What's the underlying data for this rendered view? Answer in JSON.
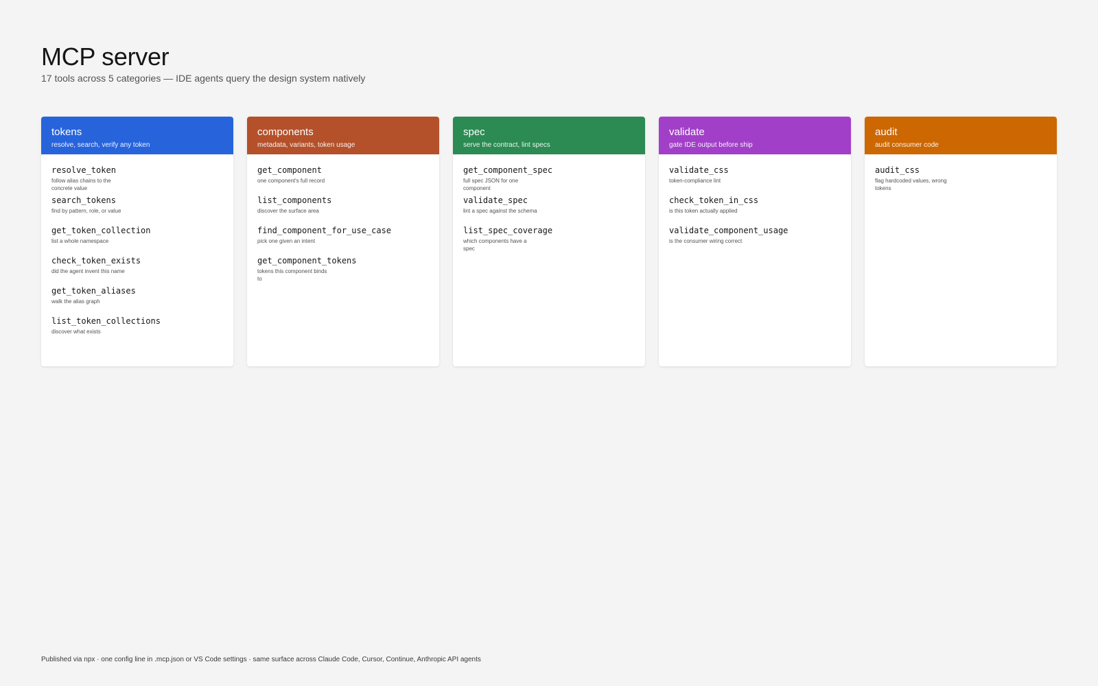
{
  "header": {
    "title": "MCP server",
    "subtitle": "17 tools across 5 categories — IDE agents query the design system natively"
  },
  "categories": [
    {
      "name": "tokens",
      "description": "resolve, search, verify any token",
      "color": "#2764dc",
      "tools": [
        {
          "name": "resolve_token",
          "description": "follow alias chains to the concrete value"
        },
        {
          "name": "search_tokens",
          "description": "find by pattern, role, or value"
        },
        {
          "name": "get_token_collection",
          "description": "list a whole namespace"
        },
        {
          "name": "check_token_exists",
          "description": "did the agent invent this name"
        },
        {
          "name": "get_token_aliases",
          "description": "walk the alias graph"
        },
        {
          "name": "list_token_collections",
          "description": "discover what exists"
        }
      ]
    },
    {
      "name": "components",
      "description": "metadata, variants, token usage",
      "color": "#b4512a",
      "tools": [
        {
          "name": "get_component",
          "description": "one component's full record"
        },
        {
          "name": "list_components",
          "description": "discover the surface area"
        },
        {
          "name": "find_component_for_use_case",
          "description": "pick one given an intent"
        },
        {
          "name": "get_component_tokens",
          "description": "tokens this component binds to"
        }
      ]
    },
    {
      "name": "spec",
      "description": "serve the contract, lint specs",
      "color": "#2b8b52",
      "tools": [
        {
          "name": "get_component_spec",
          "description": "full spec JSON for one component"
        },
        {
          "name": "validate_spec",
          "description": "lint a spec against the schema"
        },
        {
          "name": "list_spec_coverage",
          "description": "which components have a spec"
        }
      ]
    },
    {
      "name": "validate",
      "description": "gate IDE output before ship",
      "color": "#a23fc8",
      "tools": [
        {
          "name": "validate_css",
          "description": "token-compliance lint"
        },
        {
          "name": "check_token_in_css",
          "description": "is this token actually applied"
        },
        {
          "name": "validate_component_usage",
          "description": "is the consumer wiring correct"
        }
      ]
    },
    {
      "name": "audit",
      "description": "audit consumer code",
      "color": "#cc6701",
      "tools": [
        {
          "name": "audit_css",
          "description": "flag hardcoded values, wrong tokens"
        }
      ]
    }
  ],
  "footer": {
    "text": "Published via npx · one config line in .mcp.json or VS Code settings · same surface across Claude Code, Cursor, Continue, Anthropic API agents"
  }
}
